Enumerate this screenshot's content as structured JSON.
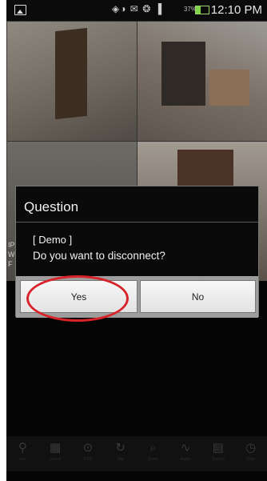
{
  "status_bar": {
    "icons": "◈◑ ✉ ❂ ▐",
    "battery_percent": "37%",
    "battery_level": 0.37,
    "time": "12:10 PM"
  },
  "feed": {
    "side_text_1": "IP",
    "side_text_2": "W",
    "side_text_3": "F"
  },
  "dialog": {
    "title": "Question",
    "line1": "[ Demo ]",
    "line2": "Do you want to disconnect?",
    "yes_label": "Yes",
    "no_label": "No"
  },
  "toolbar": {
    "items": [
      {
        "icon": "person-icon",
        "glyph": "⚲",
        "label": "Live"
      },
      {
        "icon": "grid-icon",
        "glyph": "▦",
        "label": "Layout"
      },
      {
        "icon": "ptz-icon",
        "glyph": "⊙",
        "label": "PTZ"
      },
      {
        "icon": "rotate-icon",
        "glyph": "↻",
        "label": "Flip"
      },
      {
        "icon": "zoom-icon",
        "glyph": "⌕",
        "label": "Zoom"
      },
      {
        "icon": "chart-icon",
        "glyph": "∿",
        "label": "Audio"
      },
      {
        "icon": "calendar-icon",
        "glyph": "▤",
        "label": "Search"
      },
      {
        "icon": "clock-icon",
        "glyph": "◷",
        "label": "Time"
      }
    ]
  },
  "colors": {
    "accent_circle": "#d8232a",
    "dialog_bg": "#0a0a0a",
    "button_bar": "#9d9d9d"
  }
}
